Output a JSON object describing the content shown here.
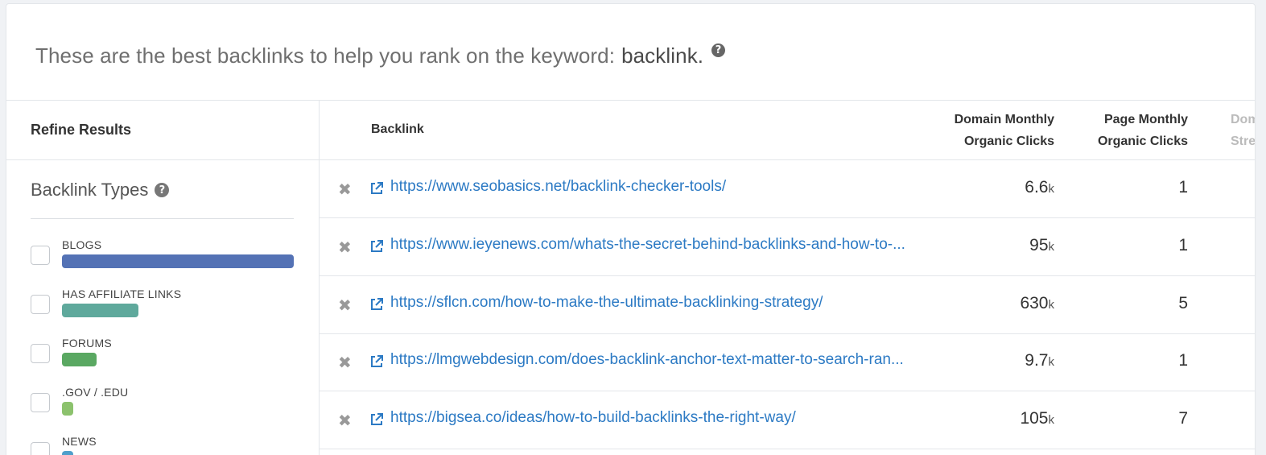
{
  "intro": {
    "text": "These are the best backlinks to help you rank on the keyword:",
    "keyword": "backlink.",
    "help_glyph": "?"
  },
  "sidebar": {
    "title": "Refine Results",
    "section_title": "Backlink Types",
    "help_glyph": "?",
    "filters": [
      {
        "label": "BLOGS",
        "color": "#5472b5",
        "fraction": 1.0
      },
      {
        "label": "HAS AFFILIATE LINKS",
        "color": "#5fa99c",
        "fraction": 0.33
      },
      {
        "label": "FORUMS",
        "color": "#5aa862",
        "fraction": 0.15
      },
      {
        "label": ".GOV / .EDU",
        "color": "#8cc26d",
        "fraction": 0.05
      },
      {
        "label": "NEWS",
        "color": "#4f9fcb",
        "fraction": 0.05
      }
    ]
  },
  "table": {
    "columns": {
      "backlink": "Backlink",
      "domain_clicks_1": "Domain Monthly",
      "domain_clicks_2": "Organic Clicks",
      "page_clicks_1": "Page Monthly",
      "page_clicks_2": "Organic Clicks",
      "domain_strength_1": "Domain",
      "domain_strength_2": "Strength"
    },
    "remove_glyph": "✖",
    "rows": [
      {
        "url": "https://www.seobasics.net/backlink-checker-tools/",
        "domain_clicks": "6.6",
        "domain_unit": "k",
        "page_clicks": "1"
      },
      {
        "url": "https://www.ieyenews.com/whats-the-secret-behind-backlinks-and-how-to-...",
        "domain_clicks": "95",
        "domain_unit": "k",
        "page_clicks": "1"
      },
      {
        "url": "https://sflcn.com/how-to-make-the-ultimate-backlinking-strategy/",
        "domain_clicks": "630",
        "domain_unit": "k",
        "page_clicks": "5"
      },
      {
        "url": "https://lmgwebdesign.com/does-backlink-anchor-text-matter-to-search-ran...",
        "domain_clicks": "9.7",
        "domain_unit": "k",
        "page_clicks": "1"
      },
      {
        "url": "https://bigsea.co/ideas/how-to-build-backlinks-the-right-way/",
        "domain_clicks": "105",
        "domain_unit": "k",
        "page_clicks": "7"
      }
    ]
  },
  "icons": {
    "remove": "close-icon",
    "external": "external-link-icon",
    "help": "question-circle-icon"
  }
}
